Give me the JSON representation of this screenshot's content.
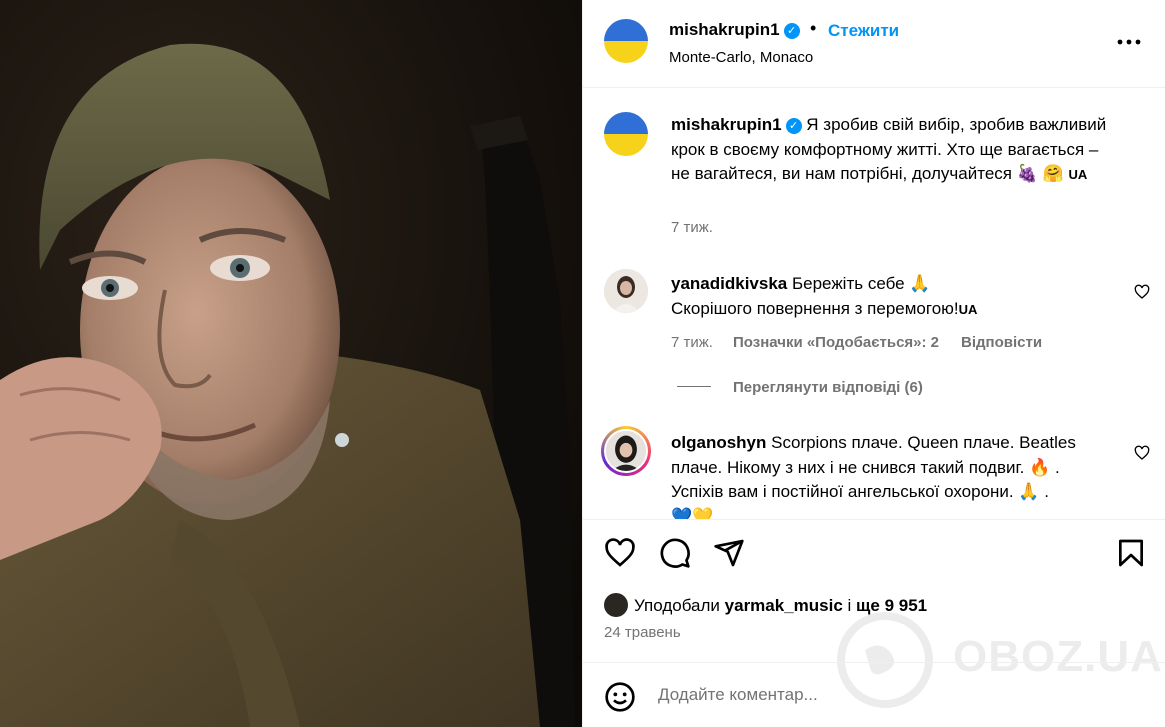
{
  "header": {
    "username": "mishakrupin1",
    "bullet": "•",
    "follow_label": "Стежити",
    "location": "Monte-Carlo, Monaco",
    "more_icon": "more-horizontal-icon"
  },
  "caption": {
    "username": "mishakrupin1",
    "text": "Я зробив свій вибір, зробив важливий крок в своєму комфортному житті. Хто ще вагається – не вагайтеся, ви нам потрібні, долучайтеся",
    "emoji": "🍇 🤗",
    "flag": "UA",
    "time": "7 тиж."
  },
  "comments": [
    {
      "username": "yanadidkivska",
      "text_line1": "Бережіть себе 🙏",
      "text_line2": "Скорішого повернення з перемогою!",
      "flag": "UA",
      "time": "7 тиж.",
      "likes": "Позначки «Подобається»: 2",
      "reply": "Відповісти",
      "view_replies": "Переглянути відповіді (6)"
    },
    {
      "username": "olganoshyn",
      "text": "Scorpions плаче. Queen плаче. Beatles плаче. Нікому з них і не снився такий подвиг. 🔥 . Успіхів вам і постійної ангельської охорони. 🙏 .",
      "trailing": "💙💛"
    }
  ],
  "likes": {
    "prefix": "Уподобали",
    "user": "yarmak_music",
    "middle": "і",
    "more": "ще 9 951"
  },
  "date": "24 травень",
  "add_comment": {
    "placeholder": "Додайте коментар..."
  },
  "watermark": "OBOZ.UA",
  "colors": {
    "link": "#0095f6",
    "muted": "#737373",
    "flag_blue": "#2f6fd6",
    "flag_yellow": "#f6d31a"
  }
}
